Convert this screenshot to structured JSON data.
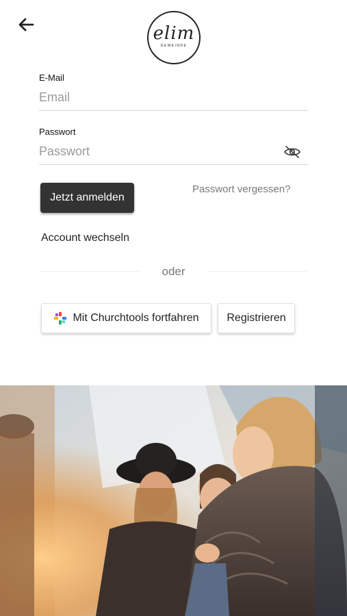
{
  "logo": {
    "main": "elim",
    "sub": "GEMEINDE"
  },
  "icons": {
    "back": "arrow-left-icon",
    "visibility": "eye-off-icon",
    "churchtools": "churchtools-logo-icon"
  },
  "email": {
    "label": "E-Mail",
    "placeholder": "Email",
    "value": ""
  },
  "password": {
    "label": "Passwort",
    "placeholder": "Passwort",
    "value": ""
  },
  "buttons": {
    "login": "Jetzt anmelden",
    "forgot": "Passwort vergessen?",
    "switch_account": "Account wechseln",
    "churchtools": "Mit Churchtools fortfahren",
    "register": "Registrieren"
  },
  "divider_text": "oder",
  "colors": {
    "primary": "#333333",
    "muted": "#7a7a7a",
    "background": "#ffffff"
  }
}
